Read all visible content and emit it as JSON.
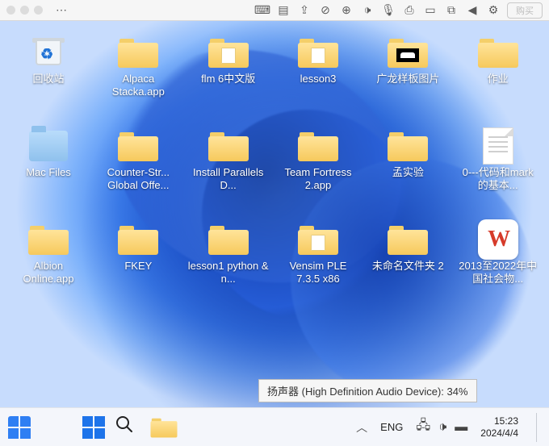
{
  "menubar": {
    "buy_label": "购买"
  },
  "desktop": {
    "icons": [
      {
        "kind": "recycle",
        "label": "回收站",
        "name": "recycle-bin"
      },
      {
        "kind": "folder",
        "label": "Alpaca Stacka.app",
        "name": "folder-alpaca-stacka"
      },
      {
        "kind": "folder-doc",
        "label": "flm 6中文版",
        "name": "folder-flm6"
      },
      {
        "kind": "folder-doc",
        "label": "lesson3",
        "name": "folder-lesson3"
      },
      {
        "kind": "folder-photo",
        "label": "广龙样板图片",
        "name": "folder-guanglong-images"
      },
      {
        "kind": "folder",
        "label": "作业",
        "name": "folder-homework"
      },
      {
        "kind": "mac-folder",
        "label": "Mac Files",
        "name": "folder-mac-files"
      },
      {
        "kind": "folder",
        "label": "Counter-Str... Global Offe...",
        "name": "folder-csgo"
      },
      {
        "kind": "folder",
        "label": "Install Parallels D...",
        "name": "folder-install-parallels"
      },
      {
        "kind": "folder",
        "label": "Team Fortress 2.app",
        "name": "folder-tf2"
      },
      {
        "kind": "folder",
        "label": "孟实验",
        "name": "folder-meng-experiment"
      },
      {
        "kind": "docfile",
        "label": "0---代码和mark的基本...",
        "name": "file-code-mark"
      },
      {
        "kind": "folder",
        "label": "Albion Online.app",
        "name": "folder-albion"
      },
      {
        "kind": "folder",
        "label": "FKEY",
        "name": "folder-fkey"
      },
      {
        "kind": "folder",
        "label": "lesson1 python & n...",
        "name": "folder-lesson1-python"
      },
      {
        "kind": "folder-doc",
        "label": "Vensim PLE 7.3.5 x86",
        "name": "folder-vensim"
      },
      {
        "kind": "folder",
        "label": "未命名文件夹 2",
        "name": "folder-untitled-2"
      },
      {
        "kind": "wps",
        "label": "2013至2022年中国社会物...",
        "name": "file-wps-2013-2022"
      }
    ]
  },
  "tooltip": {
    "text": "扬声器 (High Definition Audio Device): 34%"
  },
  "taskbar": {
    "lang": "ENG",
    "time": "15:23",
    "date": "2024/4/4"
  }
}
